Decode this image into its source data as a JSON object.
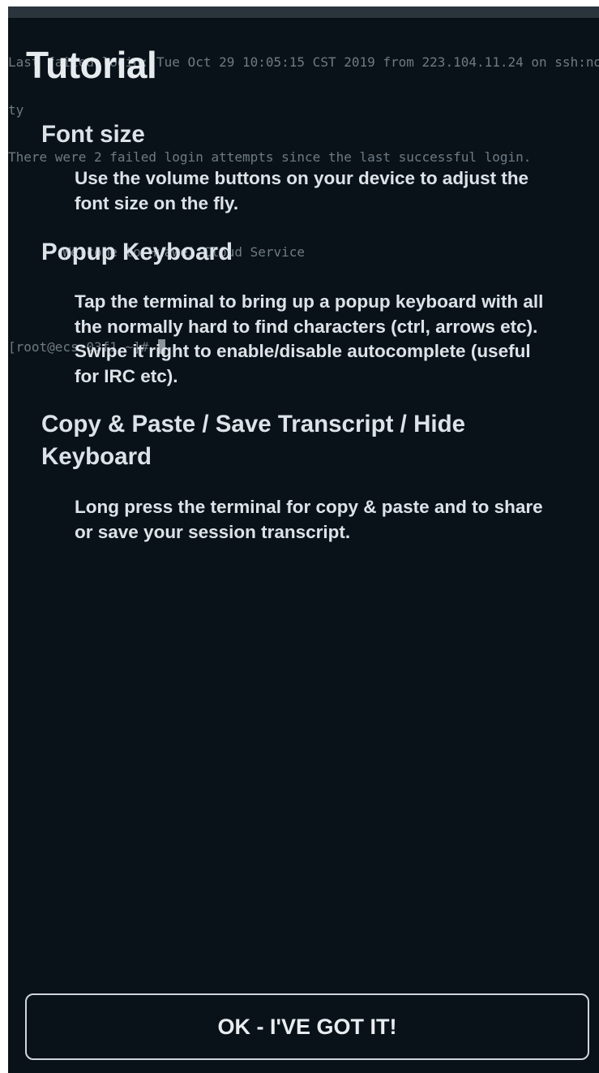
{
  "terminal": {
    "lines": [
      "Last failed login: Tue Oct 29 10:05:15 CST 2019 from 223.104.11.24 on ssh:no",
      "ty",
      "There were 2 failed login attempts since the last successful login.",
      "",
      "       Welcome to Huawei Cloud Service",
      "",
      "[root@ecs-03f1 ~]# "
    ]
  },
  "tutorial": {
    "title": "Tutorial",
    "sections": [
      {
        "heading": "Font size",
        "body": "Use the volume buttons on your device to adjust the font size on the fly."
      },
      {
        "heading": "Popup Keyboard",
        "body": "Tap the terminal to bring up a popup keyboard with all the normally hard to find characters (ctrl, arrows etc). Swipe it right to enable/disable autocomplete (useful for IRC etc)."
      },
      {
        "heading": "Copy & Paste / Save Transcript / Hide Keyboard",
        "body": "Long press the terminal for copy & paste and to share or save your session transcript."
      }
    ],
    "ok_button_label": "OK - I'VE GOT IT!"
  },
  "colors": {
    "background": "#0a1219",
    "text": "#dce3e8",
    "terminal_text": "#6e7a82"
  }
}
